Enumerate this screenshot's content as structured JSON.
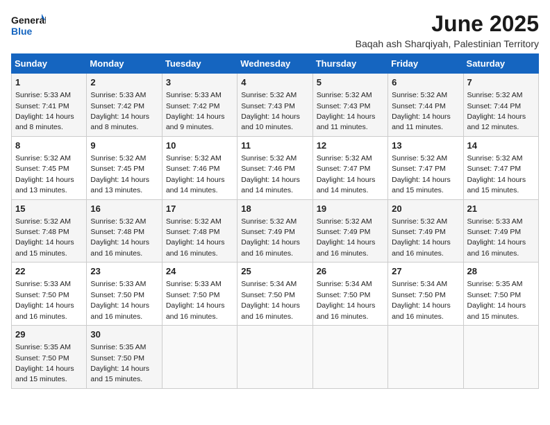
{
  "logo": {
    "line1": "General",
    "line2": "Blue"
  },
  "title": "June 2025",
  "location": "Baqah ash Sharqiyah, Palestinian Territory",
  "headers": [
    "Sunday",
    "Monday",
    "Tuesday",
    "Wednesday",
    "Thursday",
    "Friday",
    "Saturday"
  ],
  "weeks": [
    [
      {
        "day": "1",
        "sunrise": "5:33 AM",
        "sunset": "7:41 PM",
        "daylight": "14 hours and 8 minutes."
      },
      {
        "day": "2",
        "sunrise": "5:33 AM",
        "sunset": "7:42 PM",
        "daylight": "14 hours and 8 minutes."
      },
      {
        "day": "3",
        "sunrise": "5:33 AM",
        "sunset": "7:42 PM",
        "daylight": "14 hours and 9 minutes."
      },
      {
        "day": "4",
        "sunrise": "5:32 AM",
        "sunset": "7:43 PM",
        "daylight": "14 hours and 10 minutes."
      },
      {
        "day": "5",
        "sunrise": "5:32 AM",
        "sunset": "7:43 PM",
        "daylight": "14 hours and 11 minutes."
      },
      {
        "day": "6",
        "sunrise": "5:32 AM",
        "sunset": "7:44 PM",
        "daylight": "14 hours and 11 minutes."
      },
      {
        "day": "7",
        "sunrise": "5:32 AM",
        "sunset": "7:44 PM",
        "daylight": "14 hours and 12 minutes."
      }
    ],
    [
      {
        "day": "8",
        "sunrise": "5:32 AM",
        "sunset": "7:45 PM",
        "daylight": "14 hours and 13 minutes."
      },
      {
        "day": "9",
        "sunrise": "5:32 AM",
        "sunset": "7:45 PM",
        "daylight": "14 hours and 13 minutes."
      },
      {
        "day": "10",
        "sunrise": "5:32 AM",
        "sunset": "7:46 PM",
        "daylight": "14 hours and 14 minutes."
      },
      {
        "day": "11",
        "sunrise": "5:32 AM",
        "sunset": "7:46 PM",
        "daylight": "14 hours and 14 minutes."
      },
      {
        "day": "12",
        "sunrise": "5:32 AM",
        "sunset": "7:47 PM",
        "daylight": "14 hours and 14 minutes."
      },
      {
        "day": "13",
        "sunrise": "5:32 AM",
        "sunset": "7:47 PM",
        "daylight": "14 hours and 15 minutes."
      },
      {
        "day": "14",
        "sunrise": "5:32 AM",
        "sunset": "7:47 PM",
        "daylight": "14 hours and 15 minutes."
      }
    ],
    [
      {
        "day": "15",
        "sunrise": "5:32 AM",
        "sunset": "7:48 PM",
        "daylight": "14 hours and 15 minutes."
      },
      {
        "day": "16",
        "sunrise": "5:32 AM",
        "sunset": "7:48 PM",
        "daylight": "14 hours and 16 minutes."
      },
      {
        "day": "17",
        "sunrise": "5:32 AM",
        "sunset": "7:48 PM",
        "daylight": "14 hours and 16 minutes."
      },
      {
        "day": "18",
        "sunrise": "5:32 AM",
        "sunset": "7:49 PM",
        "daylight": "14 hours and 16 minutes."
      },
      {
        "day": "19",
        "sunrise": "5:32 AM",
        "sunset": "7:49 PM",
        "daylight": "14 hours and 16 minutes."
      },
      {
        "day": "20",
        "sunrise": "5:32 AM",
        "sunset": "7:49 PM",
        "daylight": "14 hours and 16 minutes."
      },
      {
        "day": "21",
        "sunrise": "5:33 AM",
        "sunset": "7:49 PM",
        "daylight": "14 hours and 16 minutes."
      }
    ],
    [
      {
        "day": "22",
        "sunrise": "5:33 AM",
        "sunset": "7:50 PM",
        "daylight": "14 hours and 16 minutes."
      },
      {
        "day": "23",
        "sunrise": "5:33 AM",
        "sunset": "7:50 PM",
        "daylight": "14 hours and 16 minutes."
      },
      {
        "day": "24",
        "sunrise": "5:33 AM",
        "sunset": "7:50 PM",
        "daylight": "14 hours and 16 minutes."
      },
      {
        "day": "25",
        "sunrise": "5:34 AM",
        "sunset": "7:50 PM",
        "daylight": "14 hours and 16 minutes."
      },
      {
        "day": "26",
        "sunrise": "5:34 AM",
        "sunset": "7:50 PM",
        "daylight": "14 hours and 16 minutes."
      },
      {
        "day": "27",
        "sunrise": "5:34 AM",
        "sunset": "7:50 PM",
        "daylight": "14 hours and 16 minutes."
      },
      {
        "day": "28",
        "sunrise": "5:35 AM",
        "sunset": "7:50 PM",
        "daylight": "14 hours and 15 minutes."
      }
    ],
    [
      {
        "day": "29",
        "sunrise": "5:35 AM",
        "sunset": "7:50 PM",
        "daylight": "14 hours and 15 minutes."
      },
      {
        "day": "30",
        "sunrise": "5:35 AM",
        "sunset": "7:50 PM",
        "daylight": "14 hours and 15 minutes."
      },
      null,
      null,
      null,
      null,
      null
    ]
  ]
}
